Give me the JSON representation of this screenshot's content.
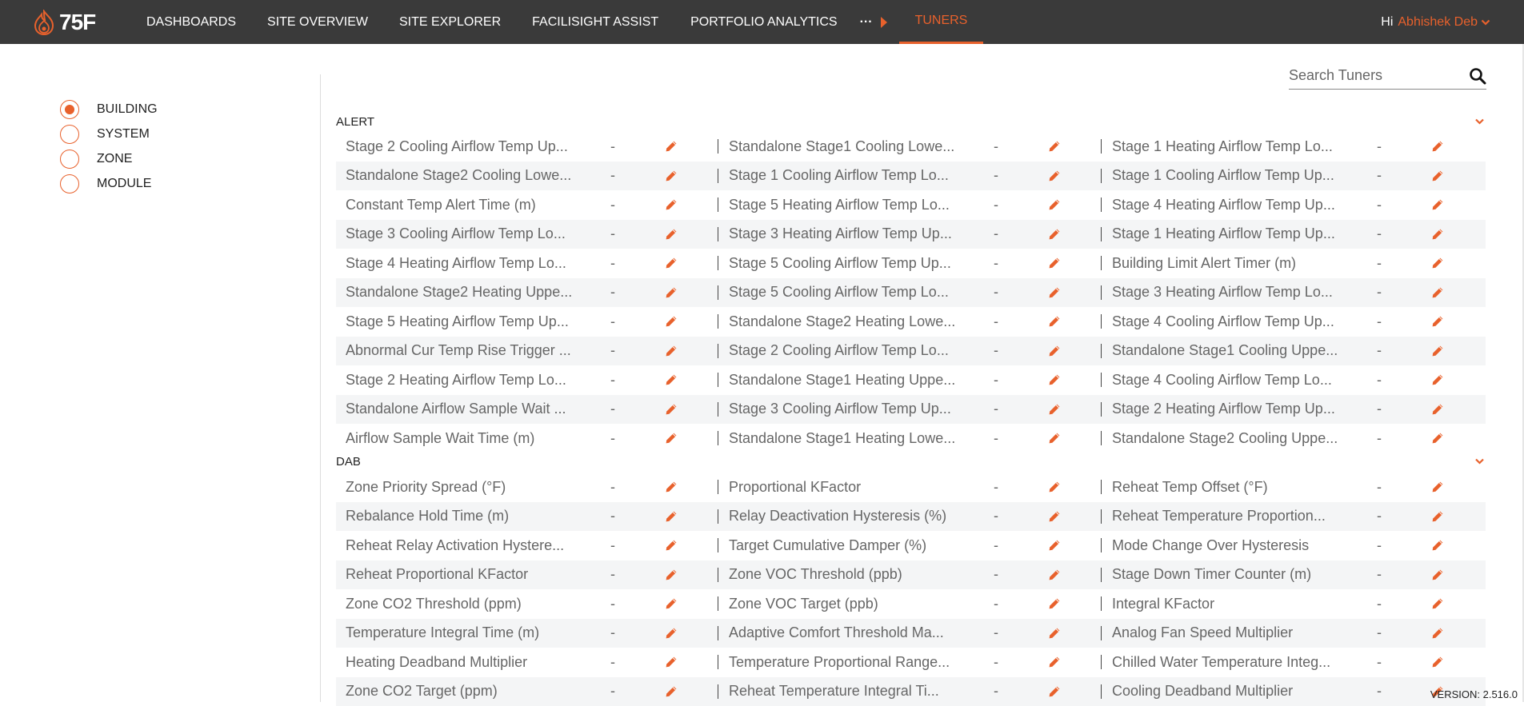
{
  "header": {
    "logo_text": "75F",
    "nav": [
      "DASHBOARDS",
      "SITE OVERVIEW",
      "SITE EXPLORER",
      "FACILISIGHT ASSIST",
      "PORTFOLIO ANALYTICS"
    ],
    "more": "···",
    "active_tab": "TUNERS",
    "greeting": "Hi",
    "user_name": "Abhishek Deb"
  },
  "levels": [
    {
      "label": "BUILDING",
      "selected": true
    },
    {
      "label": "SYSTEM",
      "selected": false
    },
    {
      "label": "ZONE",
      "selected": false
    },
    {
      "label": "MODULE",
      "selected": false
    }
  ],
  "search": {
    "placeholder": "Search Tuners"
  },
  "sections": [
    {
      "title": "ALERT",
      "rows": [
        [
          [
            "Stage 2 Cooling Airflow Temp Up...",
            "-"
          ],
          [
            "Standalone Stage1 Cooling Lowe...",
            "-"
          ],
          [
            "Stage 1 Heating Airflow Temp Lo...",
            "-"
          ]
        ],
        [
          [
            "Standalone Stage2 Cooling Lowe...",
            "-"
          ],
          [
            "Stage 1 Cooling Airflow Temp Lo...",
            "-"
          ],
          [
            "Stage 1 Cooling Airflow Temp Up...",
            "-"
          ]
        ],
        [
          [
            "Constant Temp Alert Time (m)",
            "-"
          ],
          [
            "Stage 5 Heating Airflow Temp Lo...",
            "-"
          ],
          [
            "Stage 4 Heating Airflow Temp Up...",
            "-"
          ]
        ],
        [
          [
            "Stage 3 Cooling Airflow Temp Lo...",
            "-"
          ],
          [
            "Stage 3 Heating Airflow Temp Up...",
            "-"
          ],
          [
            "Stage 1 Heating Airflow Temp Up...",
            "-"
          ]
        ],
        [
          [
            "Stage 4 Heating Airflow Temp Lo...",
            "-"
          ],
          [
            "Stage 5 Cooling Airflow Temp Up...",
            "-"
          ],
          [
            "Building Limit Alert Timer (m)",
            "-"
          ]
        ],
        [
          [
            "Standalone Stage2 Heating Uppe...",
            "-"
          ],
          [
            "Stage 5 Cooling Airflow Temp Lo...",
            "-"
          ],
          [
            "Stage 3 Heating Airflow Temp Lo...",
            "-"
          ]
        ],
        [
          [
            "Stage 5 Heating Airflow Temp Up...",
            "-"
          ],
          [
            "Standalone Stage2 Heating Lowe...",
            "-"
          ],
          [
            "Stage 4 Cooling Airflow Temp Up...",
            "-"
          ]
        ],
        [
          [
            "Abnormal Cur Temp Rise Trigger ...",
            "-"
          ],
          [
            "Stage 2 Cooling Airflow Temp Lo...",
            "-"
          ],
          [
            "Standalone Stage1 Cooling Uppe...",
            "-"
          ]
        ],
        [
          [
            "Stage 2 Heating Airflow Temp Lo...",
            "-"
          ],
          [
            "Standalone Stage1 Heating Uppe...",
            "-"
          ],
          [
            "Stage 4 Cooling Airflow Temp Lo...",
            "-"
          ]
        ],
        [
          [
            "Standalone Airflow Sample Wait ...",
            "-"
          ],
          [
            "Stage 3 Cooling Airflow Temp Up...",
            "-"
          ],
          [
            "Stage 2 Heating Airflow Temp Up...",
            "-"
          ]
        ],
        [
          [
            "Airflow Sample Wait Time (m)",
            "-"
          ],
          [
            "Standalone Stage1 Heating Lowe...",
            "-"
          ],
          [
            "Standalone Stage2 Cooling Uppe...",
            "-"
          ]
        ]
      ]
    },
    {
      "title": "DAB",
      "rows": [
        [
          [
            "Zone Priority Spread (°F)",
            "-"
          ],
          [
            "Proportional KFactor",
            "-"
          ],
          [
            "Reheat Temp Offset (°F)",
            "-"
          ]
        ],
        [
          [
            "Rebalance Hold Time (m)",
            "-"
          ],
          [
            "Relay Deactivation Hysteresis (%)",
            "-"
          ],
          [
            "Reheat Temperature Proportion...",
            "-"
          ]
        ],
        [
          [
            "Reheat Relay Activation Hystere...",
            "-"
          ],
          [
            "Target Cumulative Damper (%)",
            "-"
          ],
          [
            "Mode Change Over Hysteresis",
            "-"
          ]
        ],
        [
          [
            "Reheat Proportional KFactor",
            "-"
          ],
          [
            "Zone VOC Threshold (ppb)",
            "-"
          ],
          [
            "Stage Down Timer Counter (m)",
            "-"
          ]
        ],
        [
          [
            "Zone CO2 Threshold (ppm)",
            "-"
          ],
          [
            "Zone VOC Target (ppb)",
            "-"
          ],
          [
            "Integral KFactor",
            "-"
          ]
        ],
        [
          [
            "Temperature Integral Time (m)",
            "-"
          ],
          [
            "Adaptive Comfort Threshold Ma...",
            "-"
          ],
          [
            "Analog Fan Speed Multiplier",
            "-"
          ]
        ],
        [
          [
            "Heating Deadband Multiplier",
            "-"
          ],
          [
            "Temperature Proportional Range...",
            "-"
          ],
          [
            "Chilled Water Temperature Integ...",
            "-"
          ]
        ],
        [
          [
            "Zone CO2 Target (ppm)",
            "-"
          ],
          [
            "Reheat Temperature Integral Ti...",
            "-"
          ],
          [
            "Cooling Deadband Multiplier",
            "-"
          ]
        ]
      ]
    }
  ],
  "version": "VERSION: 2.516.0",
  "colors": {
    "accent": "#e8612c",
    "topbar": "#3a3a3a",
    "row_alt": "#f4f5f6"
  }
}
